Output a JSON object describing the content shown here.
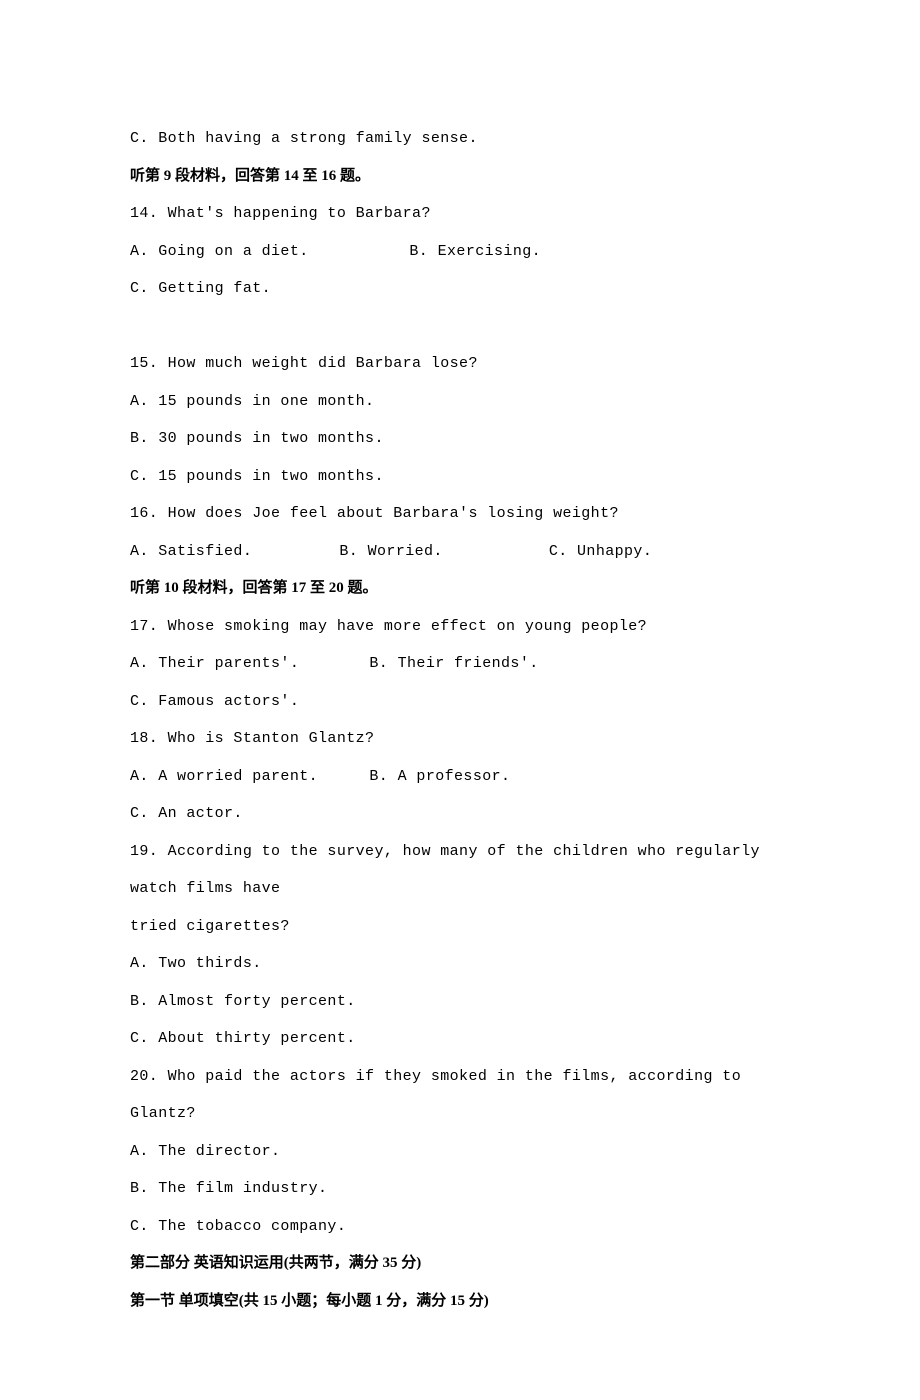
{
  "lines": {
    "l1": "C. Both having a strong family sense.",
    "h9": "听第 9 段材料，回答第 14 至 16 题。",
    "q14": "14. What's happening to Barbara?",
    "q14a": "A. Going on a diet.",
    "q14b": "B. Exercising.",
    "q14c": "C. Getting fat.",
    "q15": "15. How much weight did Barbara lose?",
    "q15a": "A. 15 pounds in one month.",
    "q15b": "B. 30 pounds in two months.",
    "q15c": "C. 15 pounds in two months.",
    "q16": "16. How does Joe feel about Barbara's losing weight?",
    "q16a": "A. Satisfied.",
    "q16b": "B. Worried.",
    "q16c": "C. Unhappy.",
    "h10": "听第 10 段材料，回答第 17 至 20 题。",
    "q17": "17. Whose smoking may have more effect on young people?",
    "q17a": "A. Their parents'.",
    "q17b": "B. Their friends'.",
    "q17c": "C. Famous actors'.",
    "q18": "18. Who is Stanton Glantz?",
    "q18a": "A. A worried parent.",
    "q18b": "B. A professor.",
    "q18c": "C. An actor.",
    "q19": "19. According to the survey, how many of the children who regularly watch films have",
    "q19cont": "tried cigarettes?",
    "q19a": "A. Two thirds.",
    "q19b": "B. Almost forty percent.",
    "q19c": "C. About thirty percent.",
    "q20": "20. Who paid the actors if they smoked in the films, according to Glantz?",
    "q20a": "A. The director.",
    "q20b": "B. The film industry.",
    "q20c": "C. The tobacco company.",
    "part2": "第二部分  英语知识运用(共两节，满分 35 分)",
    "part2s1": "第一节  单项填空(共 15 小题；每小题 1 分，满分 15 分)"
  }
}
